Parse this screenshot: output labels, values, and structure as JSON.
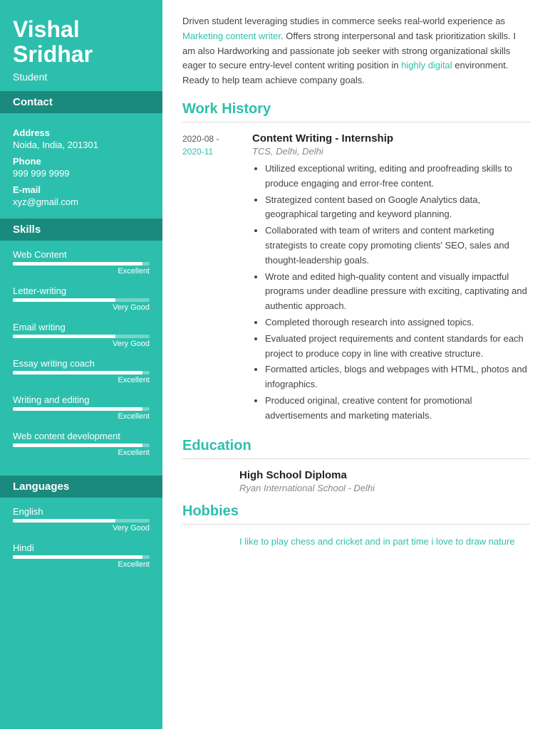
{
  "sidebar": {
    "name_line1": "Vishal",
    "name_line2": "Sridhar",
    "title": "Student",
    "contact_header": "Contact",
    "address_label": "Address",
    "address_value": "Noida, India, 201301",
    "phone_label": "Phone",
    "phone_value": "999 999 9999",
    "email_label": "E-mail",
    "email_value": "xyz@gmail.com",
    "skills_header": "Skills",
    "skills": [
      {
        "name": "Web Content",
        "level": "Excellent",
        "pct": 95
      },
      {
        "name": "Letter-writing",
        "level": "Very Good",
        "pct": 75
      },
      {
        "name": "Email writing",
        "level": "Very Good",
        "pct": 75
      },
      {
        "name": "Essay writing coach",
        "level": "Excellent",
        "pct": 95
      },
      {
        "name": "Writing and editing",
        "level": "Excellent",
        "pct": 95
      },
      {
        "name": "Web content development",
        "level": "Excellent",
        "pct": 95
      }
    ],
    "languages_header": "Languages",
    "languages": [
      {
        "name": "English",
        "level": "Very Good",
        "pct": 75
      },
      {
        "name": "Hindi",
        "level": "Excellent",
        "pct": 95
      }
    ]
  },
  "main": {
    "summary": "Driven student leveraging studies in commerce seeks real-world experience as Marketing content writer. Offers strong interpersonal and task prioritization skills. I am also Hardworking and passionate job seeker with strong organizational skills eager to secure entry-level content writing position in highly digital environment. Ready to help team achieve company goals.",
    "summary_link1": "Marketing content writer",
    "summary_highlight": "highly digital",
    "work_history_title": "Work History",
    "jobs": [
      {
        "date_start": "2020-08 -",
        "date_end": "2020-11",
        "title": "Content Writing - Internship",
        "company": "TCS, Delhi, Delhi",
        "bullets": [
          "Utilized exceptional writing, editing and proofreading skills to produce engaging and error-free content.",
          "Strategized content based on Google Analytics data, geographical targeting and keyword planning.",
          "Collaborated with team of writers and content marketing strategists to create copy promoting clients' SEO, sales and thought-leadership goals.",
          "Wrote and edited high-quality content and visually impactful programs under deadline pressure with exciting, captivating and authentic approach.",
          "Completed thorough research into assigned topics.",
          "Evaluated project requirements and content standards for each project to produce copy in line with creative structure.",
          "Formatted articles, blogs and webpages with HTML, photos and infographics.",
          "Produced original, creative content for promotional advertisements and marketing materials."
        ]
      }
    ],
    "education_title": "Education",
    "education": [
      {
        "degree": "High School Diploma",
        "school": "Ryan International School - Delhi"
      }
    ],
    "hobbies_title": "Hobbies",
    "hobbies_text": "I like to play chess and cricket and in part time i love to draw nature"
  }
}
